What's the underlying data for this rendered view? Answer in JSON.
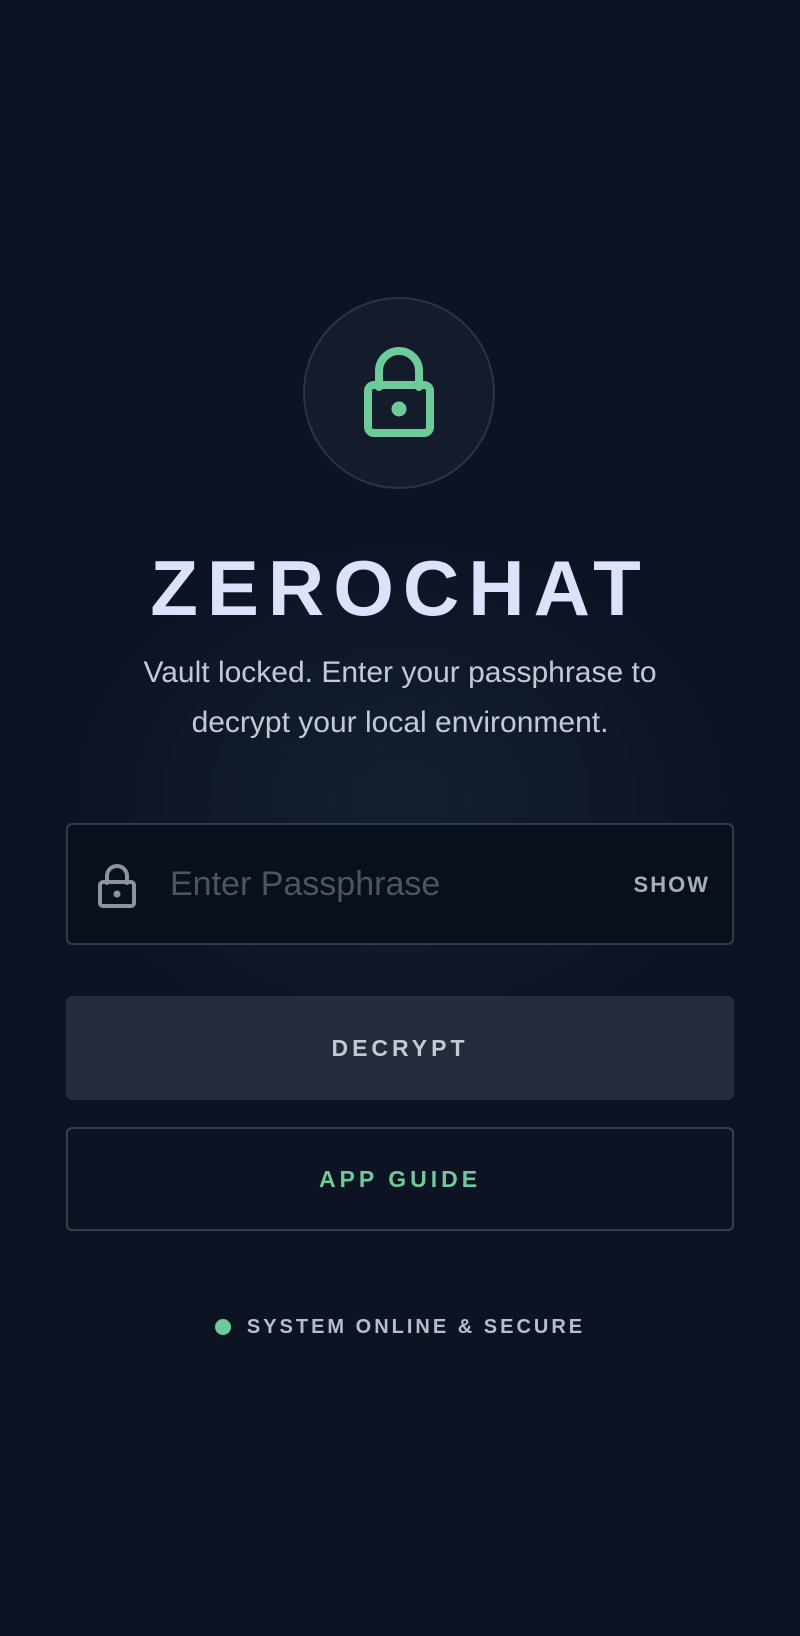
{
  "app": {
    "title": "ZEROCHAT",
    "subtitle_line1": "Vault locked. Enter your passphrase to",
    "subtitle_line2": "decrypt your local environment."
  },
  "passphrase": {
    "placeholder": "Enter Passphrase",
    "value": "",
    "toggle_label": "SHOW",
    "icon": "lock-icon"
  },
  "buttons": {
    "decrypt_label": "DECRYPT",
    "guide_label": "APP GUIDE"
  },
  "status": {
    "text": "SYSTEM ONLINE & SECURE",
    "indicator_color": "#6bcb99"
  },
  "header_icon": "lock-icon",
  "colors": {
    "background": "#0e1324",
    "accent": "#6bcb99",
    "title": "#dde1fa"
  }
}
